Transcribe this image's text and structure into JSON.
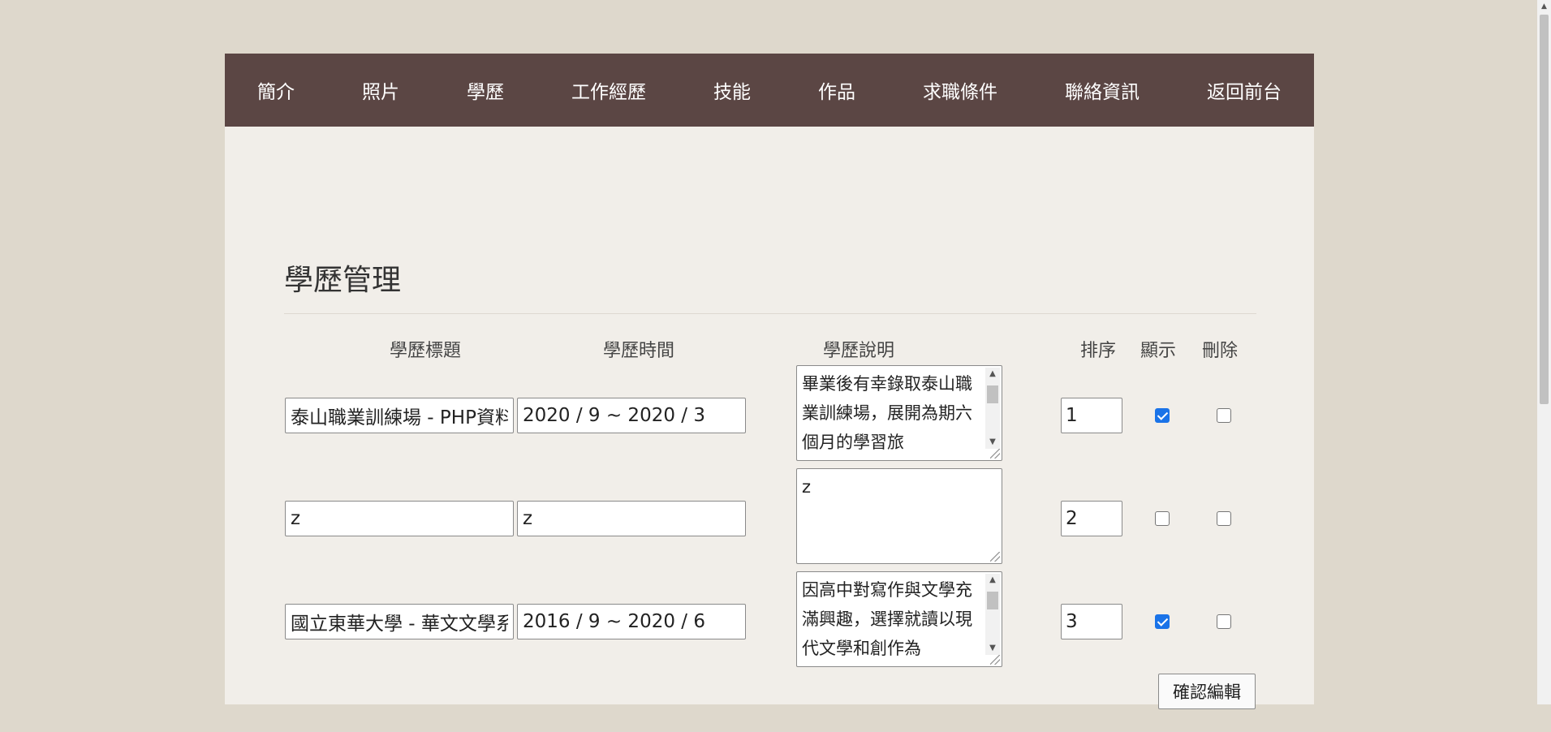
{
  "nav": {
    "items": [
      {
        "label": "簡介"
      },
      {
        "label": "照片"
      },
      {
        "label": "學歷"
      },
      {
        "label": "工作經歷"
      },
      {
        "label": "技能"
      },
      {
        "label": "作品"
      },
      {
        "label": "求職條件"
      },
      {
        "label": "聯絡資訊"
      },
      {
        "label": "返回前台"
      }
    ],
    "background": "#5b4644"
  },
  "page": {
    "title": "學歷管理"
  },
  "table": {
    "headers": {
      "title": "學歷標題",
      "time": "學歷時間",
      "desc": "學歷說明",
      "sort": "排序",
      "show": "顯示",
      "del": "刪除"
    },
    "rows": [
      {
        "title": "泰山職業訓練場 - PHP資料庫網頁設計班",
        "time": "2020 / 9 ~ 2020 / 3",
        "desc": "畢業後有幸錄取泰山職業訓練場，展開為期六個月的學習旅",
        "sort": "1",
        "show": true,
        "del": false
      },
      {
        "title": "z",
        "time": "z",
        "desc": "z",
        "sort": "2",
        "show": false,
        "del": false
      },
      {
        "title": "國立東華大學 - 華文文學系",
        "time": "2016 / 9 ~ 2020 / 6",
        "desc": "因高中對寫作與文學充滿興趣，選擇就讀以現代文學和創作為",
        "sort": "3",
        "show": true,
        "del": false
      }
    ]
  },
  "actions": {
    "confirm_label": "確認編輯"
  },
  "colors": {
    "page_bg": "#ded8cc",
    "panel_bg": "#f1eee9",
    "checkbox_checked": "#1a73e8"
  }
}
